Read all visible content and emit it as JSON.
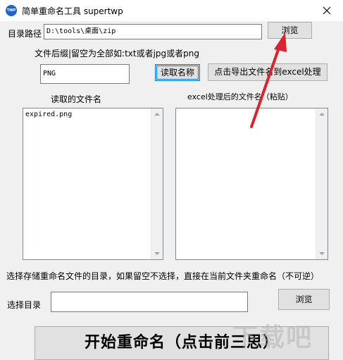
{
  "window": {
    "title": "简单重命名工具 supertwp",
    "icon_text": "TWP",
    "close_icon": "close-x"
  },
  "form": {
    "dir_label": "目录路径",
    "dir_value": "D:\\tools\\桌面\\zip",
    "browse_label": "浏览",
    "suffix_hint": "文件后缀|留空为全部如:txt或者jpg或者png",
    "suffix_value": "PNG",
    "read_names_button": "读取名称",
    "export_button": "点击导出文件名到excel处理",
    "read_list_title": "读取的文件名",
    "read_list_items": [
      "expired.png"
    ],
    "excel_list_title": "excel处理后的文件名（粘贴）",
    "excel_list_items": [],
    "save_dir_hint": "选择存储重命名文件的目录，如果留空不选择，直接在当前文件夹重命名（不可逆）",
    "select_dir_label": "选择目录",
    "select_dir_value": "",
    "browse2_label": "浏览",
    "start_button": "开始重命名（点击前三思）"
  },
  "watermark": "下载吧",
  "colors": {
    "arrow": "#d9232e",
    "focus_border": "#0078d7",
    "icon_bg": "#1e64c8"
  }
}
